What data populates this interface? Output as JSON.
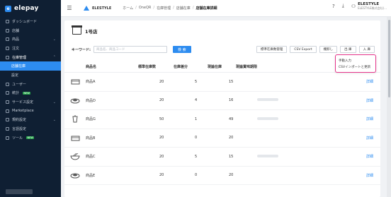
{
  "brand": {
    "name": "elepay"
  },
  "sidebar": {
    "items": [
      {
        "label": "ダッシュボード"
      },
      {
        "label": "店舗"
      },
      {
        "label": "商品"
      },
      {
        "label": "注文"
      },
      {
        "label": "在庫管理"
      },
      {
        "label": "店舗在庫"
      },
      {
        "label": "設定"
      },
      {
        "label": "ユーザー"
      },
      {
        "label": "統計",
        "badge": "NEW"
      },
      {
        "label": "サービス設定"
      },
      {
        "label": "Marketplace"
      },
      {
        "label": "規約設定"
      },
      {
        "label": "言語設定"
      },
      {
        "label": "ツール",
        "badge": "NEW"
      }
    ]
  },
  "header": {
    "store": "ELESTYLE",
    "breadcrumbs": [
      "ホーム",
      "OneQR",
      "在庫管理",
      "店舗在庫",
      "店舗在庫詳細"
    ],
    "user_name": "ELESTYLE",
    "user_sub": "ELESTYLE株式会社(..."
  },
  "page": {
    "title": "1号店",
    "keyword_label": "キーワード:",
    "search_placeholder": "商品名、商品コード",
    "search_button": "検 索",
    "tools": [
      "標準在庫数管理",
      "CSV Export",
      "棚卸し",
      "出 庫",
      "入 庫"
    ]
  },
  "dropdown": {
    "items": [
      "手動入力",
      "CSVインポートと更新"
    ]
  },
  "table": {
    "headers": [
      "商品名",
      "標準在庫数",
      "在庫差分",
      "現論在庫",
      "現論賞味期限"
    ],
    "action_label": "詳細",
    "rows": [
      {
        "name": "商品A",
        "std": "20",
        "diff": "5",
        "stock": "15",
        "icon": "food-box-icon"
      },
      {
        "name": "商品D",
        "std": "20",
        "diff": "4",
        "stock": "16",
        "icon": "sushi-roll-icon"
      },
      {
        "name": "商品G",
        "std": "50",
        "diff": "1",
        "stock": "49",
        "icon": "drink-cup-icon"
      },
      {
        "name": "商品B",
        "std": "20",
        "diff": "0",
        "stock": "20",
        "icon": "food-box-icon"
      },
      {
        "name": "商品C",
        "std": "20",
        "diff": "5",
        "stock": "15",
        "icon": "noodle-bowl-icon"
      },
      {
        "name": "商品E",
        "std": "20",
        "diff": "0",
        "stock": "20",
        "icon": "sushi-roll-icon"
      }
    ]
  },
  "colors": {
    "accent": "#2d8cf0",
    "sidebar": "#0f1f33",
    "highlight": "#e5338a"
  }
}
